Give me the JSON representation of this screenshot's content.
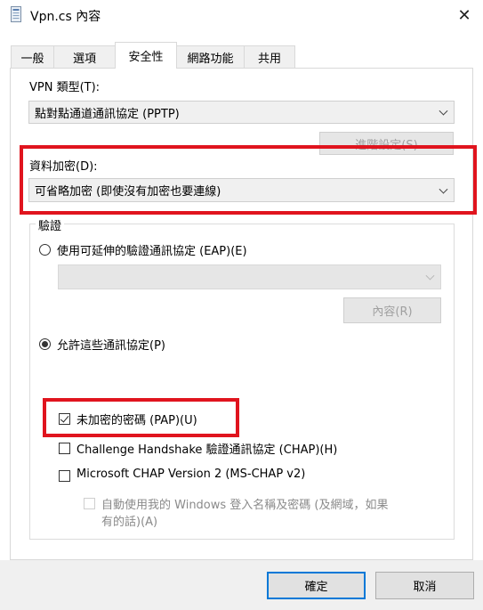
{
  "window": {
    "title": "Vpn.cs 內容",
    "icon": "document-icon",
    "close": "✕"
  },
  "tabs": [
    {
      "label": "一般",
      "active": false
    },
    {
      "label": "選項",
      "active": false
    },
    {
      "label": "安全性",
      "active": true
    },
    {
      "label": "網路功能",
      "active": false
    },
    {
      "label": "共用",
      "active": false
    }
  ],
  "vpn_type": {
    "label": "VPN 類型(T):",
    "value": "點對點通道通訊協定 (PPTP)"
  },
  "advanced_button": "進階設定(S)",
  "encryption": {
    "label": "資料加密(D):",
    "value": "可省略加密 (即使沒有加密也要連線)"
  },
  "auth": {
    "group_label": "驗證",
    "eap_radio": "使用可延伸的驗證通訊協定 (EAP)(E)",
    "eap_dropdown": "",
    "properties_button": "內容(R)",
    "allow_radio": "允許這些通訊協定(P)",
    "protocols": {
      "pap": "未加密的密碼 (PAP)(U)",
      "chap": "Challenge Handshake 驗證通訊協定 (CHAP)(H)",
      "mschap": "Microsoft CHAP Version 2 (MS-CHAP v2)",
      "auto_logon_line1": "自動使用我的 Windows 登入名稱及密碼 (及網域，如果",
      "auto_logon_line2": "有的話)(A)"
    }
  },
  "footer": {
    "ok": "確定",
    "cancel": "取消"
  },
  "highlight_color": "#e0141e"
}
